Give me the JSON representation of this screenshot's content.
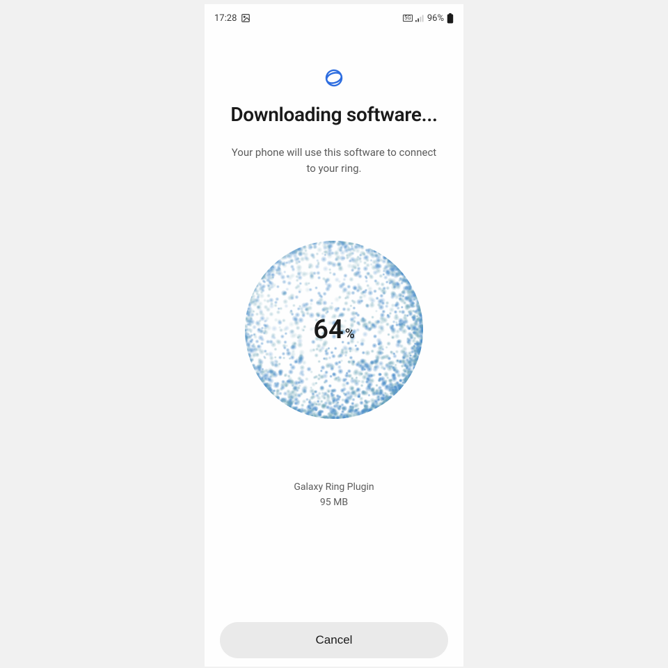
{
  "status_bar": {
    "time": "17:28",
    "network_label": "5G",
    "battery_text": "96%"
  },
  "header": {
    "title": "Downloading software...",
    "subtitle": "Your phone will use this software to connect to your ring."
  },
  "progress": {
    "value": "64",
    "percent_symbol": "%"
  },
  "plugin": {
    "name": "Galaxy Ring Plugin",
    "size": "95 MB"
  },
  "actions": {
    "cancel_label": "Cancel"
  }
}
